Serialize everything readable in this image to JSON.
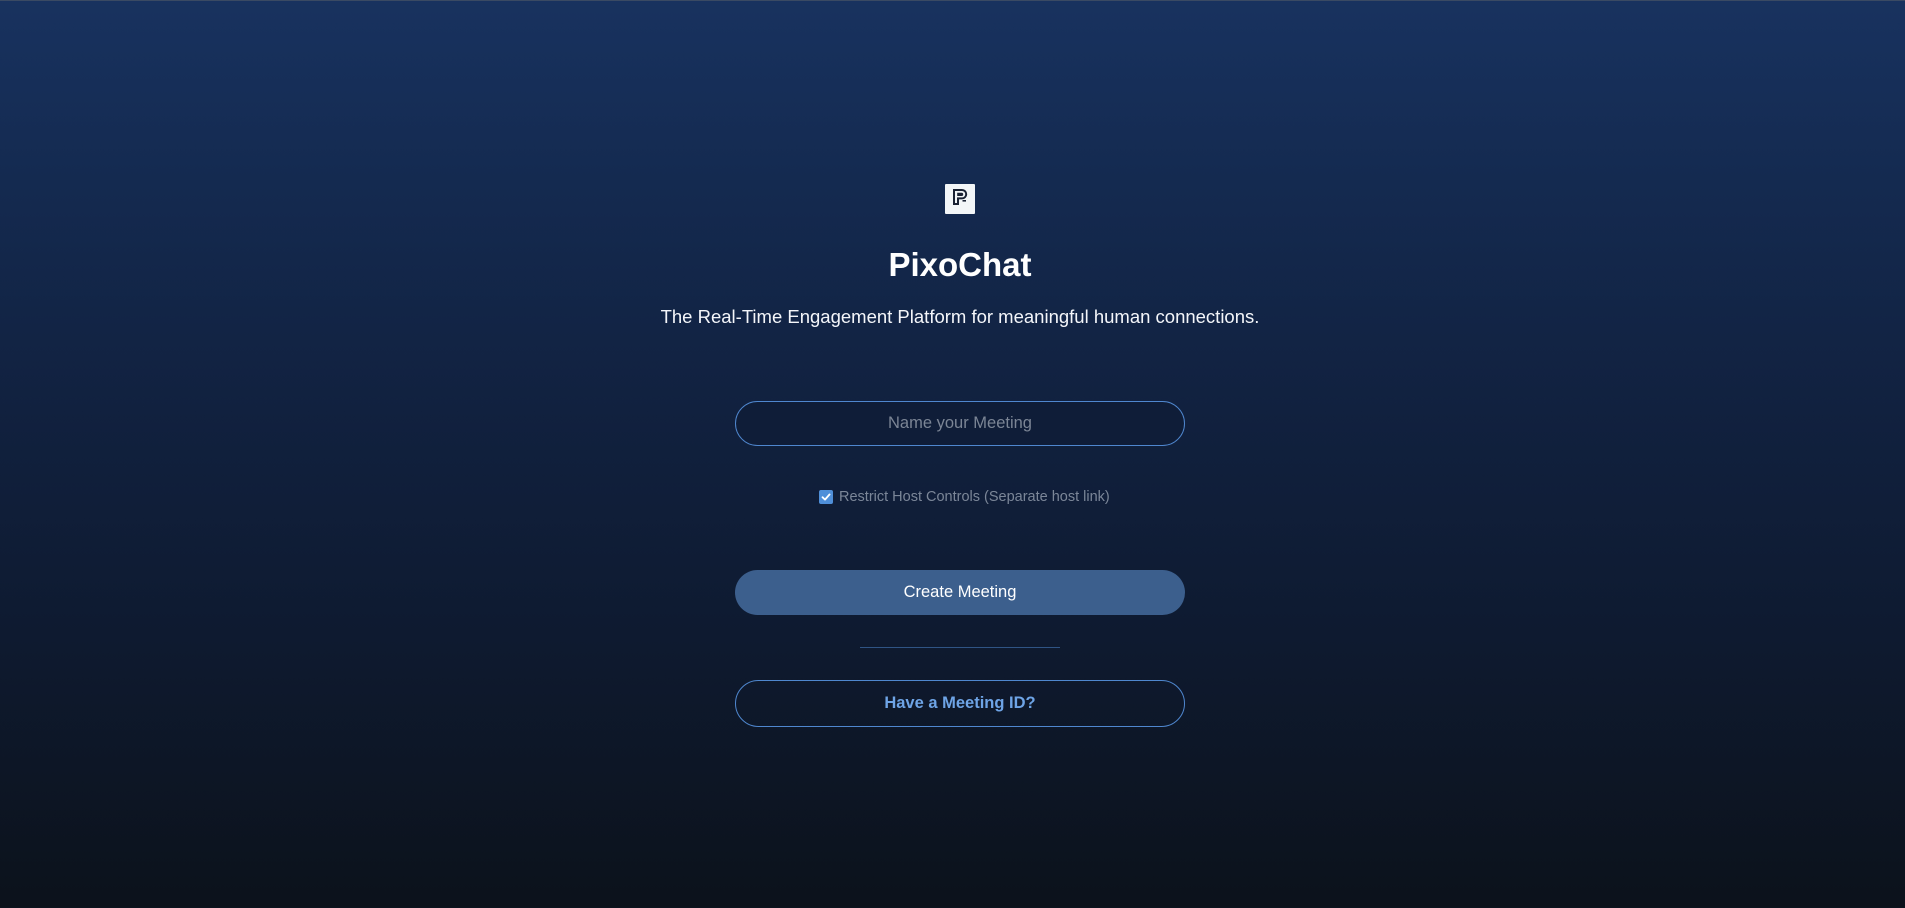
{
  "app": {
    "logo_icon": "pixochat-logo-icon",
    "title": "PixoChat",
    "tagline": "The Real-Time Engagement Platform for meaningful human connections."
  },
  "form": {
    "meeting_name_value": "",
    "meeting_name_placeholder": "Name your Meeting",
    "restrict_checked": true,
    "restrict_label": "Restrict Host Controls (Separate host link)",
    "create_label": "Create Meeting",
    "meeting_id_label": "Have a Meeting ID?"
  },
  "colors": {
    "accent": "#4f87cf",
    "button_fill": "#3c5f8d",
    "link_text": "#6ea4e6"
  }
}
